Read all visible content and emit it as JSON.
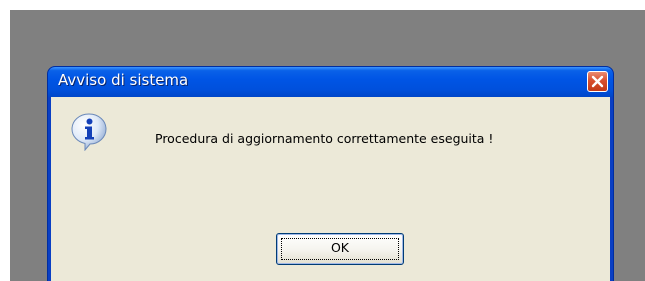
{
  "dialog": {
    "title": "Avviso di sistema",
    "message": "Procedura di aggiornamento correttamente eseguita !",
    "ok_label": "OK",
    "icon": "info-icon",
    "close_icon": "close-icon"
  },
  "colors": {
    "desktop": "#808080",
    "titlebar": "#0055e5",
    "client": "#ece9d8",
    "close_button": "#d8502f"
  }
}
